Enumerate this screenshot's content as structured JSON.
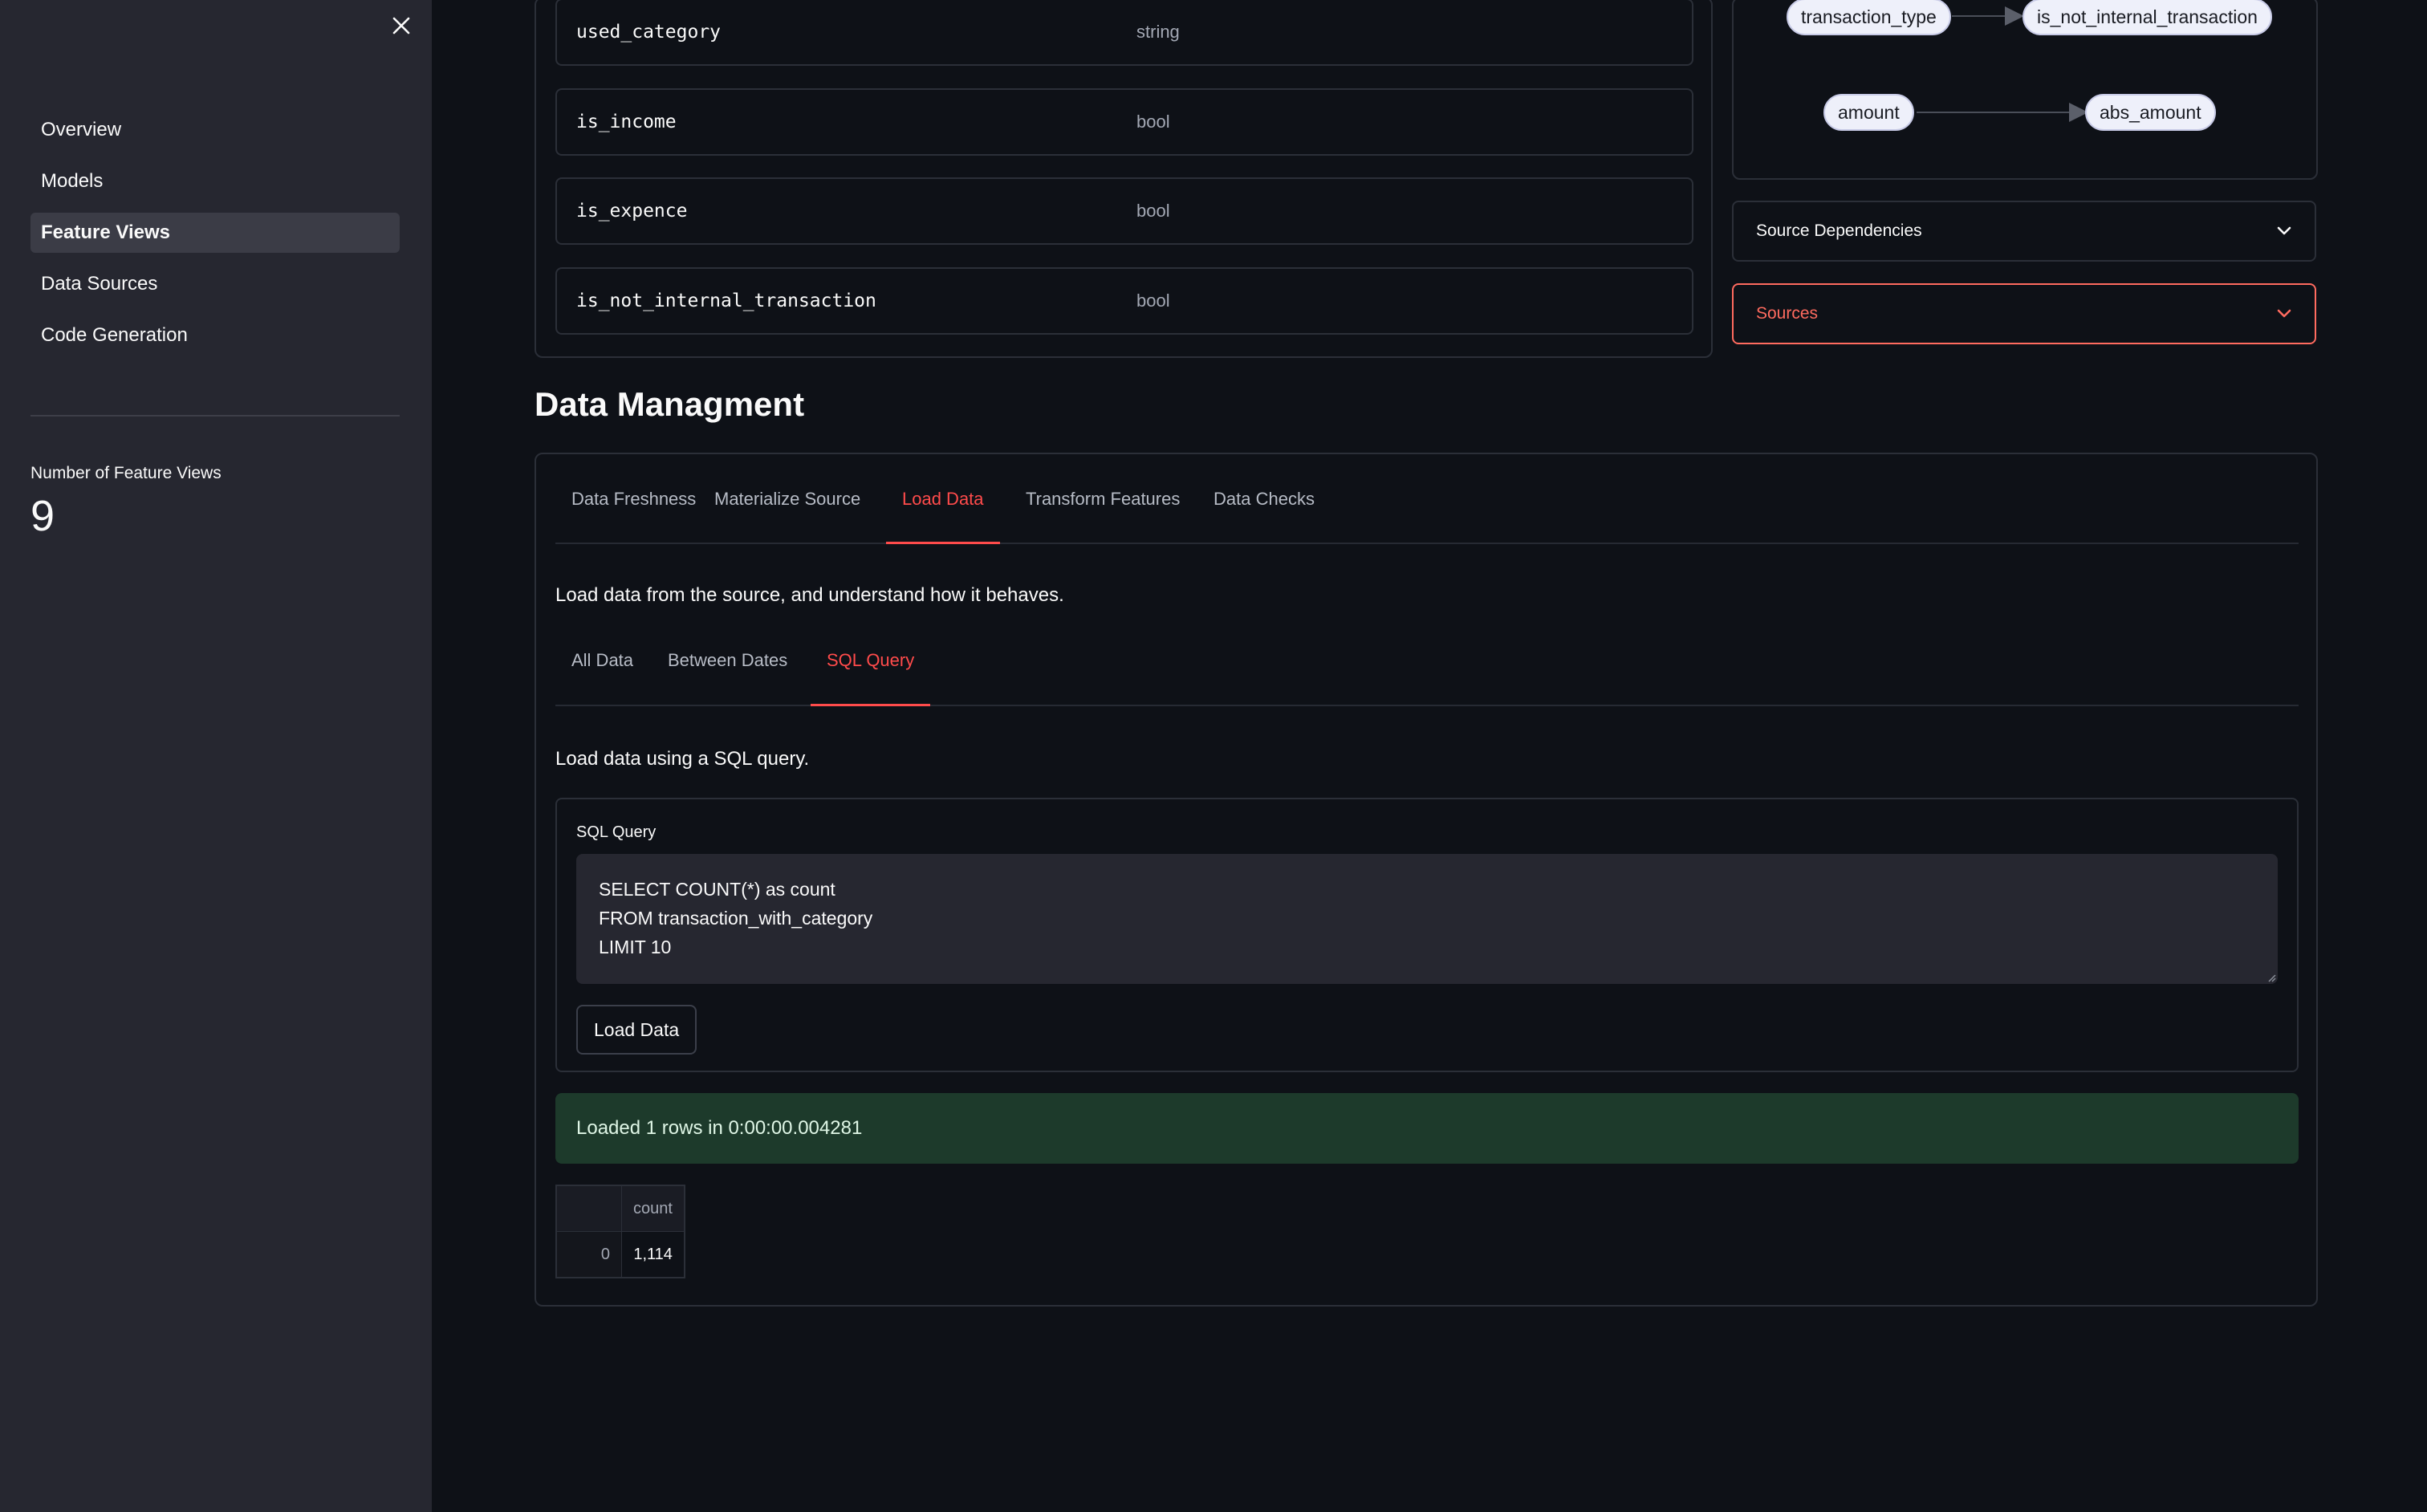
{
  "sidebar": {
    "nav": [
      {
        "label": "Overview",
        "active": false
      },
      {
        "label": "Models",
        "active": false
      },
      {
        "label": "Feature Views",
        "active": true
      },
      {
        "label": "Data Sources",
        "active": false
      },
      {
        "label": "Code Generation",
        "active": false
      }
    ],
    "metric": {
      "label": "Number of Feature Views",
      "value": "9"
    }
  },
  "schema": {
    "rows": [
      {
        "name": "used_category",
        "type": "string"
      },
      {
        "name": "is_income",
        "type": "bool"
      },
      {
        "name": "is_expence",
        "type": "bool"
      },
      {
        "name": "is_not_internal_transaction",
        "type": "bool"
      }
    ]
  },
  "graph": {
    "edges": [
      {
        "from": "transaction_type",
        "to": "is_not_internal_transaction"
      },
      {
        "from": "amount",
        "to": "abs_amount"
      }
    ]
  },
  "expanders": {
    "source_dependencies": "Source Dependencies",
    "sources": "Sources"
  },
  "data_management": {
    "title": "Data Managment",
    "tabs": [
      {
        "label": "Data Freshness",
        "active": false
      },
      {
        "label": "Materialize Source",
        "active": false
      },
      {
        "label": "Load Data",
        "active": true
      },
      {
        "label": "Transform Features",
        "active": false
      },
      {
        "label": "Data Checks",
        "active": false
      }
    ],
    "description": "Load data from the source, and understand how it behaves.",
    "subtabs": [
      {
        "label": "All Data",
        "active": false
      },
      {
        "label": "Between Dates",
        "active": false
      },
      {
        "label": "SQL Query",
        "active": true
      }
    ],
    "sql_description": "Load data using a SQL query.",
    "query_label": "SQL Query",
    "query_value": "SELECT COUNT(*) as count\nFROM transaction_with_category\nLIMIT 10",
    "load_button": "Load Data",
    "success_message": "Loaded 1 rows in 0:00:00.004281",
    "result_table": {
      "columns": [
        "count"
      ],
      "rows": [
        {
          "index": "0",
          "count": "1,114"
        }
      ]
    }
  },
  "colors": {
    "accent": "#ff4b4b",
    "success_bg": "#1d3a2b",
    "background": "#0e1117",
    "sidebar": "#262730"
  }
}
